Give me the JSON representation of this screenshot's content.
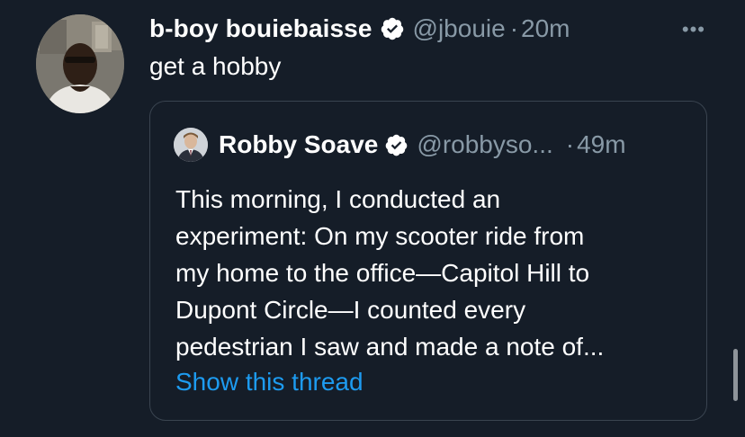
{
  "tweet": {
    "display_name": "b-boy bouiebaisse",
    "handle": "@jbouie",
    "separator": "·",
    "time": "20m",
    "more_label": "•••",
    "text": "get a hobby"
  },
  "quote": {
    "display_name": "Robby Soave",
    "handle": "@robbyso...",
    "separator": "·",
    "time": "49m",
    "lines": [
      "This morning, I conducted an",
      "experiment: On my scooter ride from",
      "my home to the office—Capitol Hill to",
      "Dupont Circle—I counted every",
      "pedestrian I saw and made a note of..."
    ],
    "show_thread": "Show this thread"
  },
  "colors": {
    "background": "#151d28",
    "text": "#ffffff",
    "secondary": "#8899a6",
    "link": "#1d9bf0",
    "verified": "#ffffff"
  },
  "icons": {
    "verified": "verified-badge-icon",
    "more": "more-options-icon"
  }
}
